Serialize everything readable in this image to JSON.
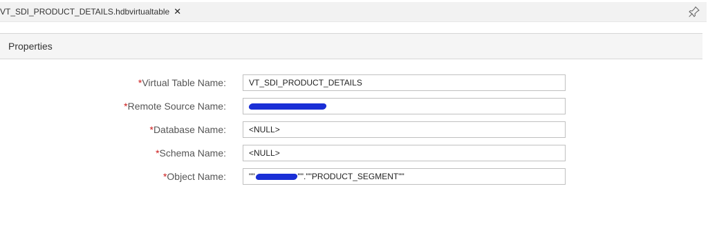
{
  "tabbar": {
    "tab_label": "VT_SDI_PRODUCT_DETAILS.hdbvirtualtable",
    "close_glyph": "✕",
    "pin_icon": "pin-icon"
  },
  "panel": {
    "title": "Properties"
  },
  "form": {
    "required_marker": "*",
    "fields": [
      {
        "label": "Virtual Table Name:",
        "value": "VT_SDI_PRODUCT_DETAILS"
      },
      {
        "label": "Remote Source Name:",
        "value": "",
        "redacted": true
      },
      {
        "label": "Database Name:",
        "value": "<NULL>"
      },
      {
        "label": "Schema Name:",
        "value": "<NULL>"
      },
      {
        "label": "Object Name:",
        "value_prefix": "\"\"",
        "value_suffix": "\"\".\"\"PRODUCT_SEGMENT\"\"",
        "redacted": true
      }
    ]
  },
  "colors": {
    "required": "#cc1919",
    "redaction": "#1a2fd6",
    "header_bg": "#f5f5f5"
  }
}
